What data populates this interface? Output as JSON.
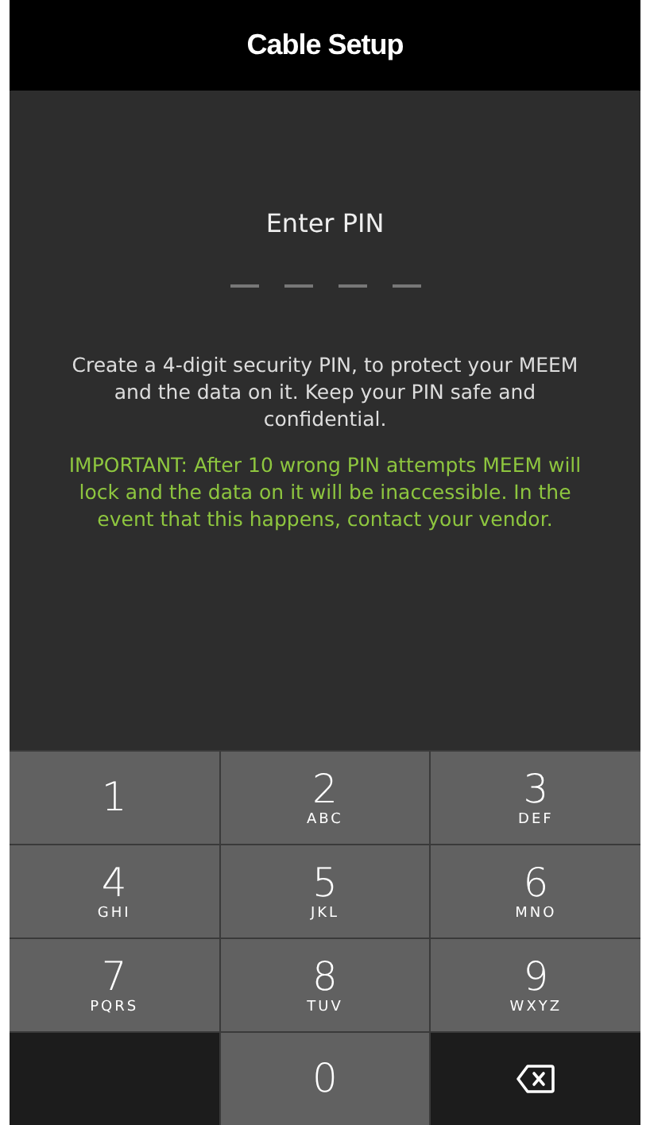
{
  "header": {
    "title": "Cable Setup"
  },
  "prompt": "Enter PIN",
  "pin_slots": [
    {
      "filled": false
    },
    {
      "filled": false
    },
    {
      "filled": false
    },
    {
      "filled": false
    }
  ],
  "description": "Create a 4-digit security PIN, to protect your MEEM and the data on it. Keep your PIN safe and confidential.",
  "warning": "IMPORTANT: After 10 wrong PIN attempts MEEM will lock and the data on it will be inaccessible. In the event that this happens, contact your vendor.",
  "keypad": [
    {
      "kind": "digit",
      "digit": "1"
    },
    {
      "kind": "digit",
      "digit": "2",
      "letters": "ABC"
    },
    {
      "kind": "digit",
      "digit": "3",
      "letters": "DEF"
    },
    {
      "kind": "digit",
      "digit": "4",
      "letters": "GHI"
    },
    {
      "kind": "digit",
      "digit": "5",
      "letters": "JKL"
    },
    {
      "kind": "digit",
      "digit": "6",
      "letters": "MNO"
    },
    {
      "kind": "digit",
      "digit": "7",
      "letters": "PQRS"
    },
    {
      "kind": "digit",
      "digit": "8",
      "letters": "TUV"
    },
    {
      "kind": "digit",
      "digit": "9",
      "letters": "WXYZ"
    },
    {
      "kind": "blank"
    },
    {
      "kind": "digit",
      "digit": "0"
    },
    {
      "kind": "backspace"
    }
  ]
}
